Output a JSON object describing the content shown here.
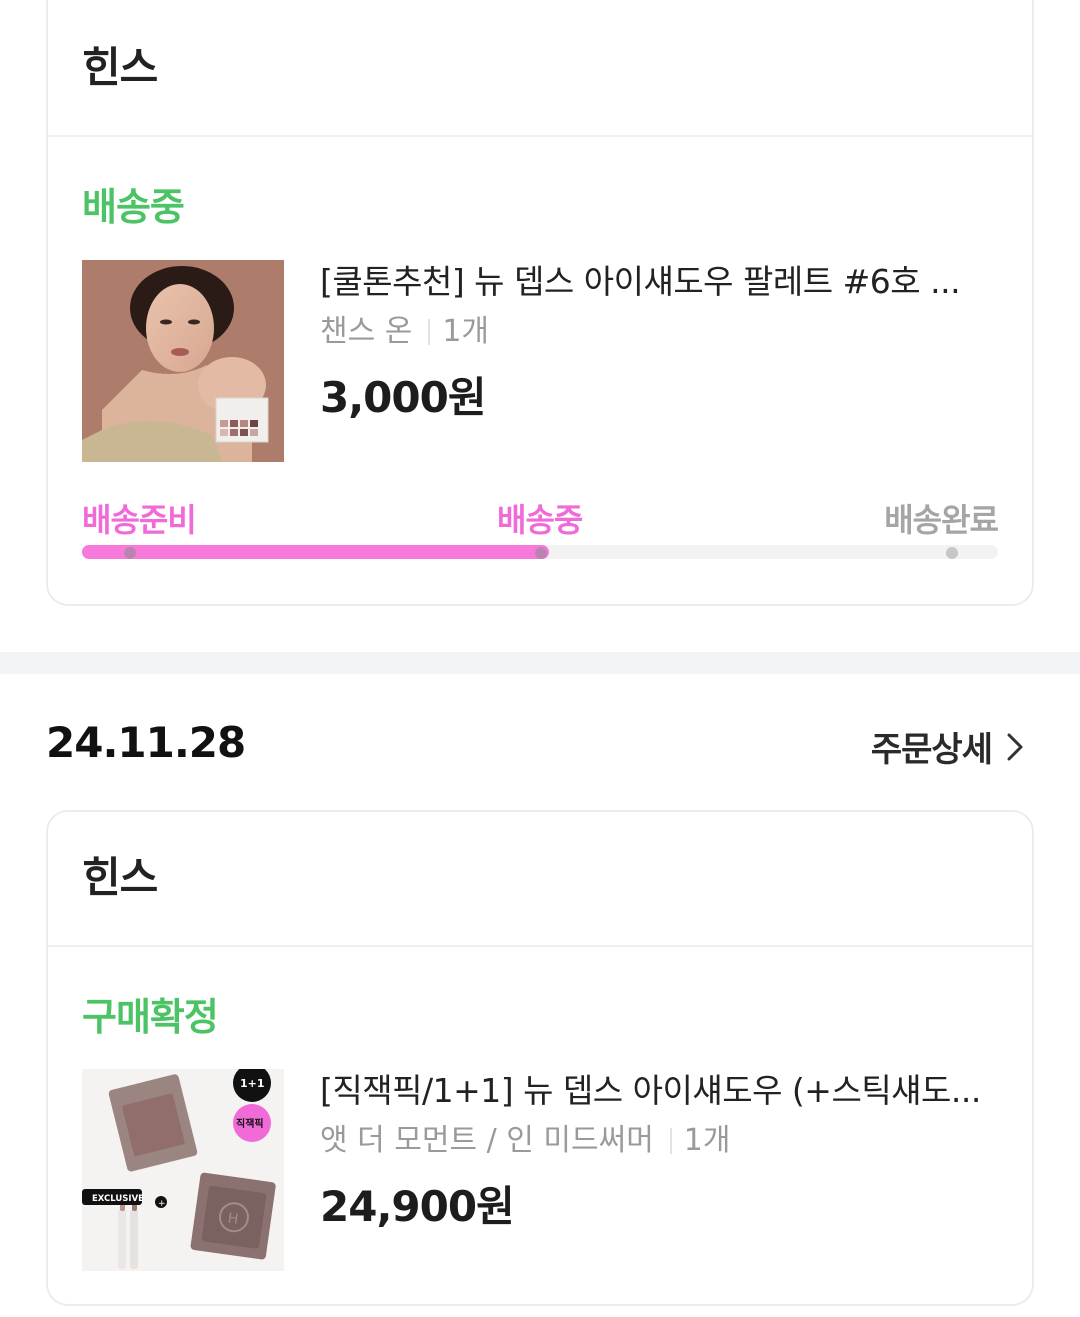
{
  "order1": {
    "brand": "힌스",
    "status": "배송중",
    "product": {
      "title": "[쿨톤추천] 뉴 뎁스 아이섀도우 팔레트 #6호 ...",
      "option": "챈스 온",
      "quantity": "1개",
      "price": "3,000원",
      "image_icon": "product-photo-model-with-palette"
    },
    "progress": {
      "steps": [
        "배송준비",
        "배송중",
        "배송완료"
      ],
      "current_step": 2,
      "fraction": 0.51
    }
  },
  "order2": {
    "date": "24.11.28",
    "detail_label": "주문상세",
    "detail_icon": "chevron-right-icon",
    "brand": "힌스",
    "status": "구매확정",
    "product": {
      "title": "[직잭픽/1+1] 뉴 뎁스 아이섀도우 (+스틱섀도...",
      "option": "앳 더 모먼트 / 인 미드써머",
      "quantity": "1개",
      "price": "24,900원",
      "badge_one_plus_one": "1+1",
      "badge_pick": "직잭픽",
      "badge_exclusive": "EXCLUSIVE"
    }
  },
  "colors": {
    "status_green": "#4cc466",
    "progress_pink": "#f879dc",
    "step_active": "#f06ad8",
    "step_inactive": "#a5a5a5"
  }
}
